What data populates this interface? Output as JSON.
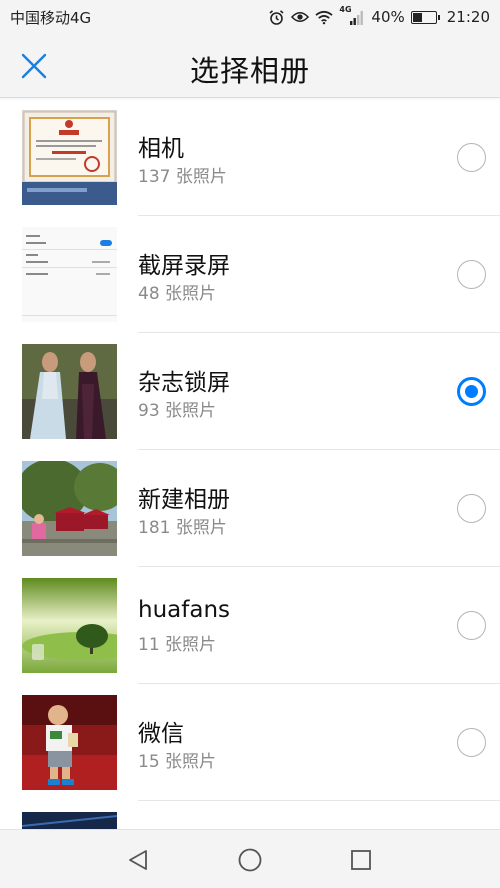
{
  "status_bar": {
    "carrier": "中国移动4G",
    "network_badge": "4G",
    "battery_percent": "40%",
    "battery_level": 0.4,
    "time": "21:20",
    "icons": [
      "alarm-icon",
      "eye-icon",
      "wifi-icon",
      "signal-icon",
      "battery-icon"
    ]
  },
  "header": {
    "title": "选择相册",
    "close_icon": "close-icon"
  },
  "accent_color": "#007dff",
  "albums": [
    {
      "name": "相机",
      "count": "137 张照片",
      "selected": false
    },
    {
      "name": "截屏录屏",
      "count": "48 张照片",
      "selected": false
    },
    {
      "name": "杂志锁屏",
      "count": "93 张照片",
      "selected": true
    },
    {
      "name": "新建相册",
      "count": "181 张照片",
      "selected": false
    },
    {
      "name": "huafans",
      "count": "11 张照片",
      "selected": false
    },
    {
      "name": "微信",
      "count": "15 张照片",
      "selected": false
    }
  ],
  "nav_bar": {
    "buttons": [
      "back-icon",
      "home-icon",
      "recents-icon"
    ]
  }
}
